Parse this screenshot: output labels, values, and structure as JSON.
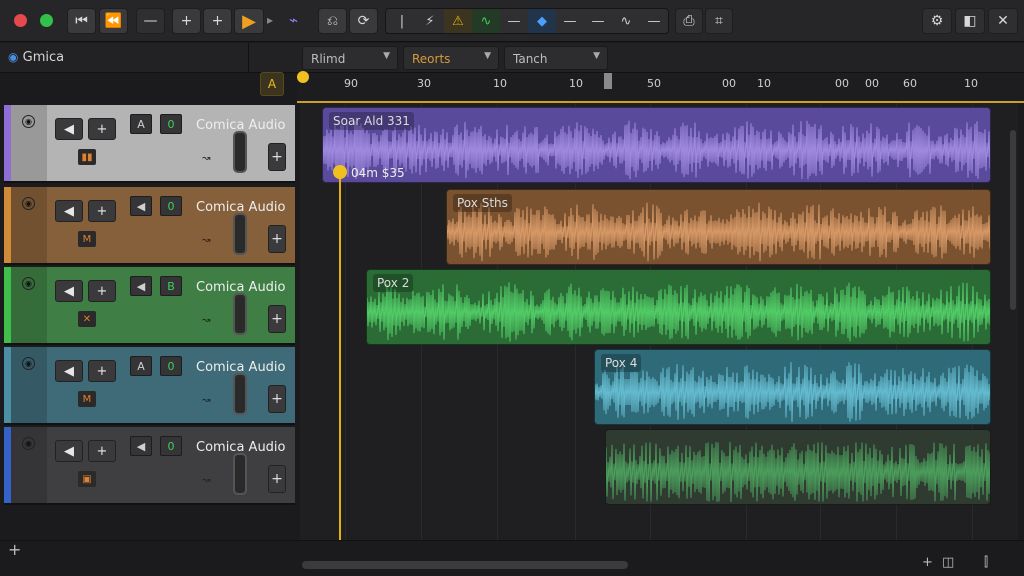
{
  "window": {
    "project_name": "Gmica"
  },
  "toolbar": {
    "skip_back": "⏮",
    "rewind": "⏪",
    "minus1": "—",
    "plus1": "+",
    "plus2": "+",
    "minus2": "—",
    "play": "▶",
    "next": "▸",
    "wave": "⌁",
    "loop1": "⎌",
    "loop2": "⟳",
    "tools": [
      "|",
      "⚡",
      "⚠",
      "∿",
      "—",
      "◆",
      "—",
      "—",
      "∿",
      "—"
    ],
    "right": [
      "⎙",
      "⌗"
    ],
    "far_right": [
      "⚙",
      "◧",
      "✕"
    ]
  },
  "header": {
    "dropdowns": [
      "Rlimd",
      "Reorts",
      "Tanch"
    ],
    "marker_btn": "A"
  },
  "ruler": {
    "ticks": [
      "90",
      "30",
      "10",
      "10",
      "50",
      "00",
      "10",
      "00",
      "00",
      "60",
      "10"
    ]
  },
  "tracks": [
    {
      "name": "Comica Audio",
      "color": "#8f6fd6",
      "bg": "#b4b4b4",
      "mute": "A",
      "solo": "0",
      "mode": "▮▮",
      "region": {
        "label": "Soar Ald 331",
        "time": "04m $35",
        "color": "#5a4a9b",
        "wave": "#a590e6"
      }
    },
    {
      "name": "Comica Audio",
      "color": "#d08a3a",
      "bg": "#86603a",
      "mute": "◀",
      "solo": "0",
      "mode": "M",
      "region": {
        "label": "Pox Sths",
        "color": "#7a5230",
        "wave": "#e0a06d"
      }
    },
    {
      "name": "Comica Audio",
      "color": "#3fbf4a",
      "bg": "#3f7f45",
      "mute": "◀",
      "solo": "B",
      "mode": "✕",
      "region": {
        "label": "Pox 2",
        "color": "#2b6b35",
        "wave": "#56d66d"
      }
    },
    {
      "name": "Comica Audio",
      "color": "#4a8fa4",
      "bg": "#3f6a77",
      "mute": "A",
      "solo": "0",
      "mode": "M",
      "region": {
        "label": "Pox 4",
        "color": "#2f6a78",
        "wave": "#6ac3d8"
      }
    },
    {
      "name": "Comica Audio",
      "color": "#3462c7",
      "bg": "#3f3f41",
      "mute": "◀",
      "solo": "0",
      "mode": "▣",
      "region": {
        "label": "",
        "color": "#2f3a30",
        "wave": "#4fa862"
      }
    }
  ],
  "bottom": {
    "add": "+",
    "icons": [
      "+",
      "◫",
      "⫿"
    ]
  },
  "colors": {
    "accent": "#e3b20a",
    "panel": "#262628"
  }
}
